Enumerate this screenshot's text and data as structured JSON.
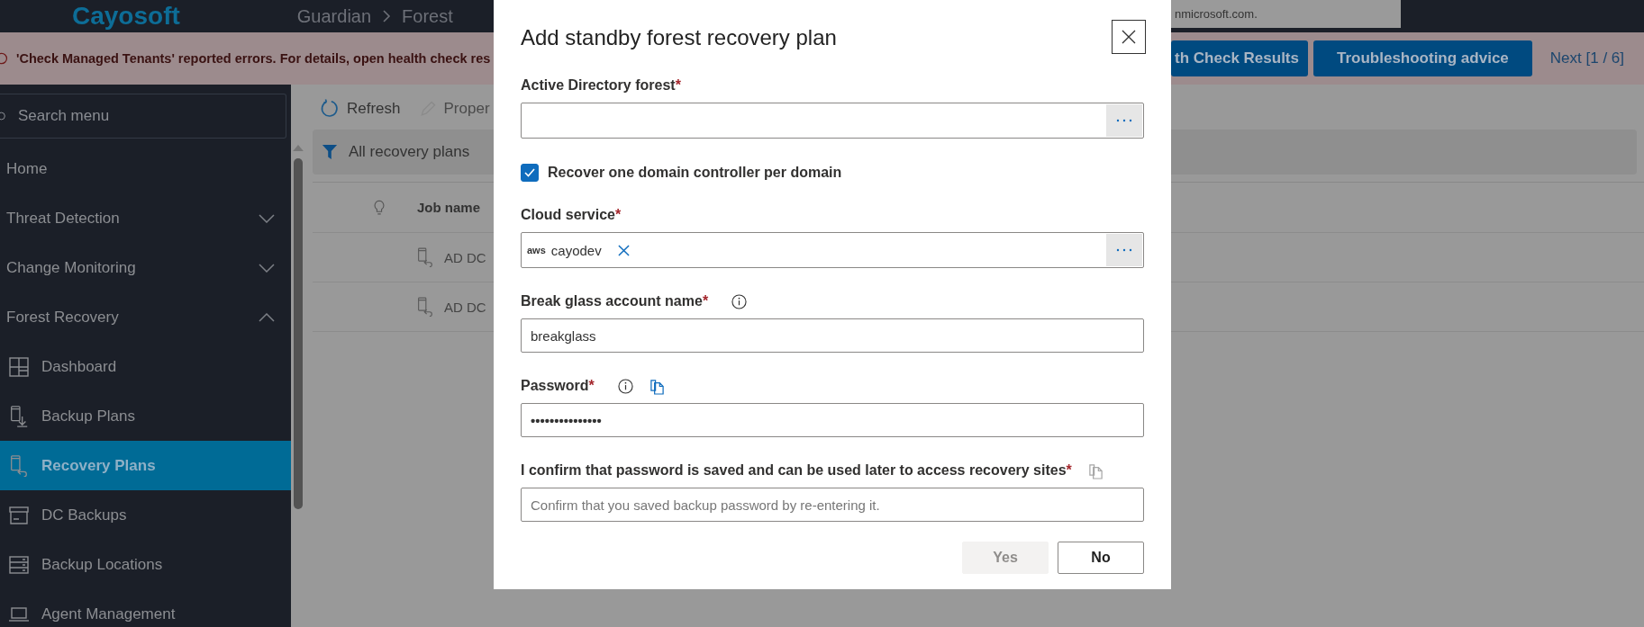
{
  "header": {
    "logo": "Cayosoft",
    "breadcrumb": [
      "Guardian",
      "Forest"
    ],
    "tenant": "nmicrosoft.com."
  },
  "banner": {
    "message": "'Check Managed Tenants' reported errors. For details, open health check res",
    "buttons": [
      "th Check Results",
      "Troubleshooting advice"
    ],
    "next": "Next [1 / 6]"
  },
  "sidebar": {
    "search": {
      "placeholder": "Search menu"
    },
    "items": [
      {
        "kind": "link",
        "label": "Home",
        "selected": false
      },
      {
        "kind": "group",
        "label": "Threat Detection",
        "expanded": false
      },
      {
        "kind": "group",
        "label": "Change Monitoring",
        "expanded": false
      },
      {
        "kind": "group",
        "label": "Forest Recovery",
        "expanded": true,
        "children": [
          {
            "label": "Dashboard",
            "selected": false
          },
          {
            "label": "Backup Plans",
            "selected": false
          },
          {
            "label": "Recovery Plans",
            "selected": true
          },
          {
            "label": "DC Backups",
            "selected": false
          },
          {
            "label": "Backup Locations",
            "selected": false
          },
          {
            "label": "Agent Management",
            "selected": false
          }
        ]
      }
    ]
  },
  "toolbar": [
    "Refresh",
    "Proper"
  ],
  "filter": "All recovery plans",
  "table": {
    "columns": [
      "Job name"
    ],
    "rows": [
      {
        "job_name": "AD DC"
      },
      {
        "job_name": "AD DC"
      }
    ]
  },
  "dialog": {
    "title": "Add standby forest recovery plan",
    "fields": [
      {
        "kind": "picker",
        "label": "Active Directory forest",
        "required_mark": "*"
      },
      {
        "kind": "checkbox",
        "label": "Recover one domain controller per domain",
        "checked": true
      },
      {
        "kind": "picker",
        "label": "Cloud service",
        "required_mark": "*",
        "chip": {
          "logo": "aws",
          "label": "cayodev"
        }
      },
      {
        "kind": "text",
        "label": "Break glass account name",
        "required_mark": "*",
        "info": true,
        "value": "breakglass"
      },
      {
        "kind": "password",
        "label": "Password",
        "required_mark": "*",
        "info": true,
        "copy": {
          "disabled": false
        },
        "value": "•••••••••••••••"
      },
      {
        "kind": "text",
        "label": "I confirm that password is saved and can be used later to access recovery sites",
        "required_mark": "*",
        "copy": {
          "disabled": true
        },
        "placeholder": "Confirm that you saved backup password by re-entering it."
      }
    ],
    "buttons": [
      {
        "label": "Yes",
        "disabled": true
      },
      {
        "label": "No",
        "disabled": false
      }
    ]
  }
}
